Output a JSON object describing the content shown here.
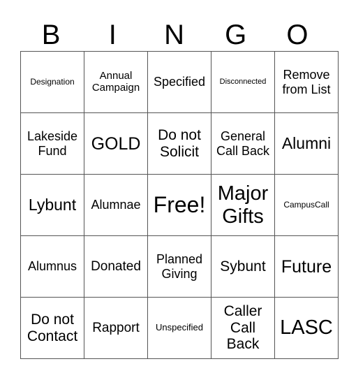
{
  "header": {
    "letters": [
      "B",
      "I",
      "N",
      "G",
      "O"
    ]
  },
  "board": {
    "rows": [
      [
        "Designation",
        "Annual Campaign",
        "Specified",
        "Disconnected",
        "Remove from List"
      ],
      [
        "Lakeside Fund",
        "GOLD",
        "Do not Solicit",
        "General Call Back",
        "Alumni"
      ],
      [
        "Lybunt",
        "Alumnae",
        "Free!",
        "Major Gifts",
        "CampusCall"
      ],
      [
        "Alumnus",
        "Donated",
        "Planned Giving",
        "Sybunt",
        "Future"
      ],
      [
        "Do not Contact",
        "Rapport",
        "Unspecified",
        "Caller Call Back",
        "LASC"
      ]
    ]
  }
}
